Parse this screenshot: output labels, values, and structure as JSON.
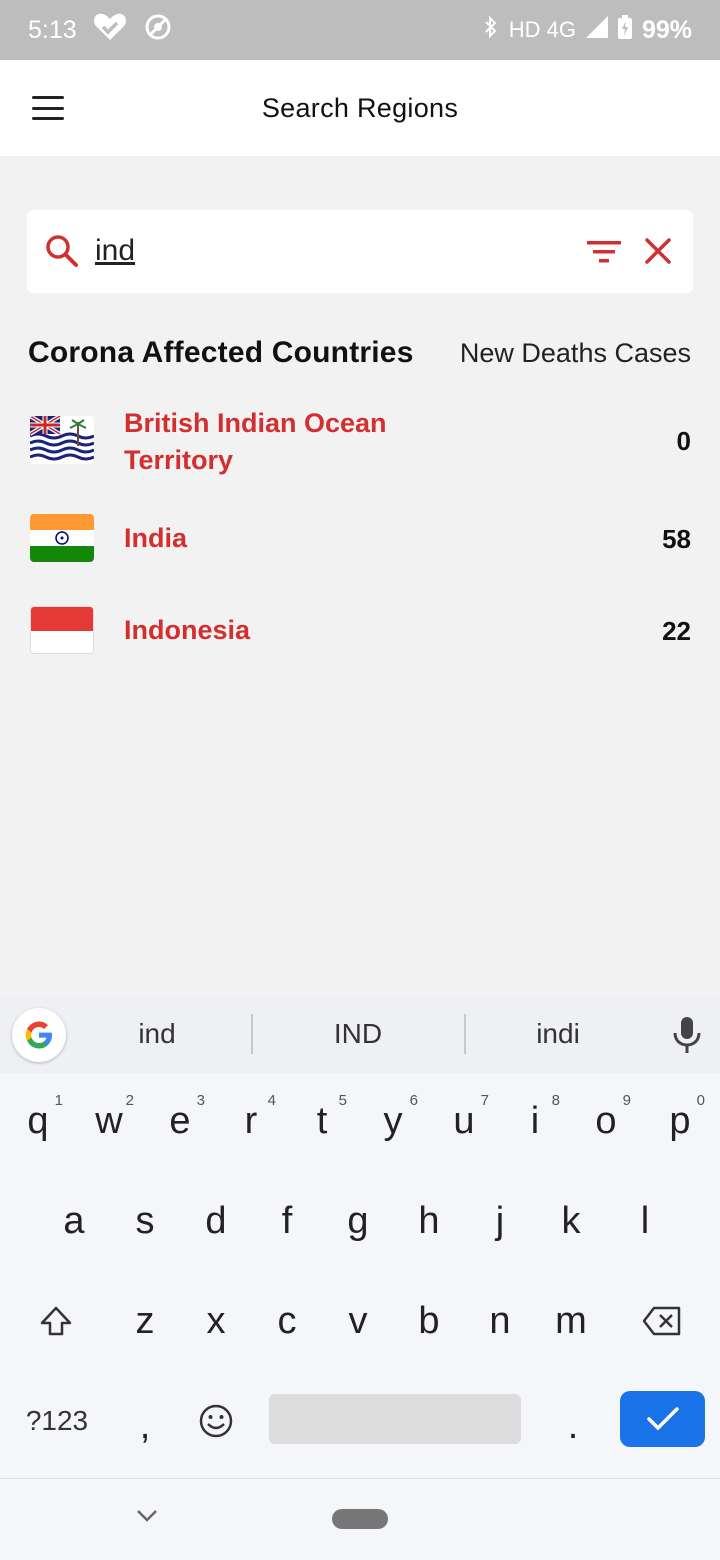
{
  "status_bar": {
    "time": "5:13",
    "network": "HD 4G",
    "battery": "99%"
  },
  "app_bar": {
    "title": "Search Regions"
  },
  "search": {
    "value": "ind"
  },
  "section": {
    "title": "Corona Affected Countries",
    "column_label": "New Deaths Cases"
  },
  "countries": [
    {
      "name_line1": "British Indian Ocean",
      "name_line2": "Territory",
      "count": "0"
    },
    {
      "name": "India",
      "count": "58"
    },
    {
      "name": "Indonesia",
      "count": "22"
    }
  ],
  "keyboard": {
    "suggestions": [
      "ind",
      "IND",
      "indi"
    ],
    "row1": [
      "q",
      "w",
      "e",
      "r",
      "t",
      "y",
      "u",
      "i",
      "o",
      "p"
    ],
    "row1_hints": [
      "1",
      "2",
      "3",
      "4",
      "5",
      "6",
      "7",
      "8",
      "9",
      "0"
    ],
    "row2": [
      "a",
      "s",
      "d",
      "f",
      "g",
      "h",
      "j",
      "k",
      "l"
    ],
    "row3": [
      "z",
      "x",
      "c",
      "v",
      "b",
      "n",
      "m"
    ],
    "symbols_label": "?123",
    "comma": ",",
    "period": "."
  },
  "colors": {
    "accent": "#d32f2f",
    "enter_key": "#1a73e8"
  }
}
